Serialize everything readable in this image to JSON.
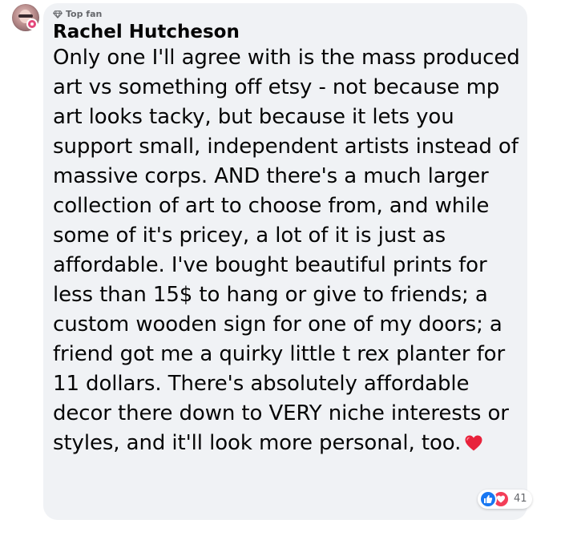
{
  "comment": {
    "badge_icon": "diamond-icon",
    "badge_label": "Top fan",
    "author": "Rachel Hutcheson",
    "text": "Only one I'll agree with is the mass produced art vs something off etsy - not because mp art looks tacky, but because it lets you support small, independent artists instead of massive corps. AND there's a much larger collection of art to choose from, and while some of it's pricey, a lot of it is just as affordable. I've bought beautiful prints for less than 15$ to hang or give to friends; a custom wooden sign for one of my doors; a friend got me a quirky little t rex planter for 11 dollars. There's absolutely affordable decor there down to VERY niche interests or styles, and it'll look more personal, too.",
    "trailing_emoji": "red-heart-icon"
  },
  "reactions": {
    "icons": [
      "like-icon",
      "love-icon"
    ],
    "count": "41"
  },
  "colors": {
    "bubble_bg": "#f0f2f5",
    "text": "#050505",
    "secondary_text": "#65676b",
    "like_blue": "#1877f2",
    "love_red": "#f33e58",
    "avatar_badge": "#e4487b"
  }
}
